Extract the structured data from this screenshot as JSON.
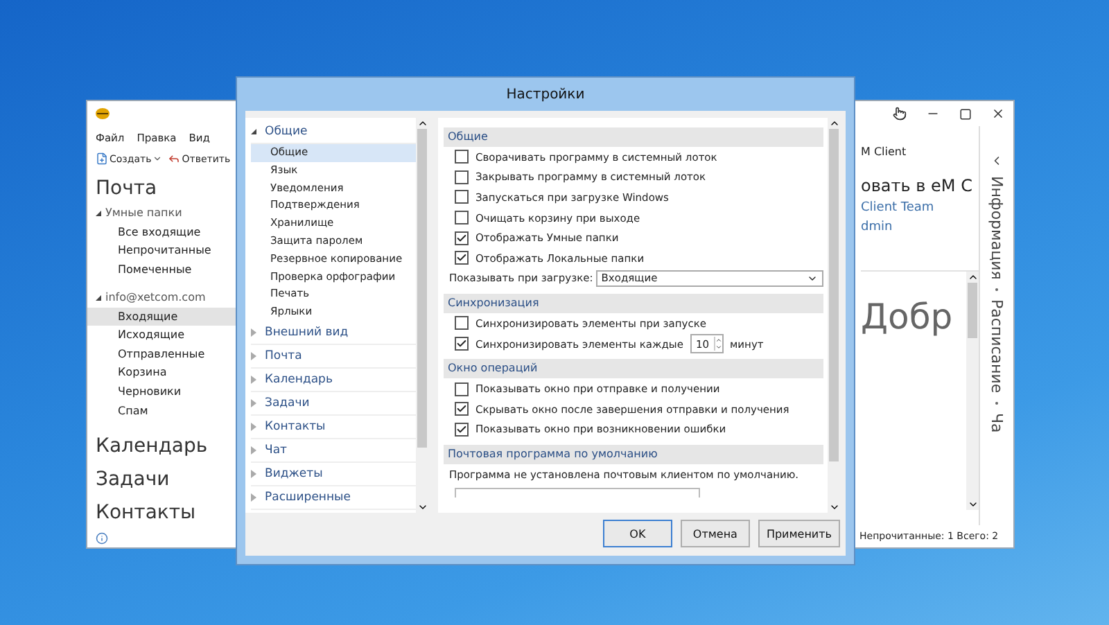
{
  "mail_window": {
    "menu": [
      "Файл",
      "Правка",
      "Вид"
    ],
    "toolbar": [
      {
        "kind": "new",
        "label": "Создать"
      },
      {
        "kind": "reply",
        "label": "Ответить"
      }
    ],
    "nav": [
      {
        "label": "Почта",
        "groups": [
          {
            "label": "Умные папки",
            "expanded": true,
            "selected": false,
            "children": [
              {
                "label": "Все входящие",
                "selected": false
              },
              {
                "label": "Непрочитанные",
                "selected": false
              },
              {
                "label": "Помеченные",
                "selected": false
              }
            ]
          },
          {
            "label": "info@xetcom.com",
            "expanded": true,
            "selected": false,
            "children": [
              {
                "label": "Входящие",
                "selected": true
              },
              {
                "label": "Исходящие",
                "selected": false
              },
              {
                "label": "Отправленные",
                "selected": false
              },
              {
                "label": "Корзина",
                "selected": false
              },
              {
                "label": "Черновики",
                "selected": false
              },
              {
                "label": "Спам",
                "selected": false
              }
            ]
          }
        ]
      },
      {
        "label": "Календарь"
      },
      {
        "label": "Задачи"
      },
      {
        "label": "Контакты"
      }
    ],
    "reading_pane": {
      "title": "M Client",
      "subject": "овать в eM C",
      "from": "Client Team",
      "to": "dmin",
      "preview_text": "Добр"
    },
    "side_tabs": [
      "Информация",
      "Расписание",
      "Ча"
    ],
    "status": "Непрочитанные: 1 Всего: 2"
  },
  "dialog": {
    "title": "Настройки",
    "categories": [
      {
        "label": "Общие",
        "expanded": true,
        "selected": false,
        "children": [
          {
            "label": "Общие",
            "selected": true
          },
          {
            "label": "Язык",
            "selected": false
          },
          {
            "label": "Уведомления",
            "selected": false
          },
          {
            "label": "Подтверждения",
            "selected": false
          },
          {
            "label": "Хранилище",
            "selected": false
          },
          {
            "label": "Защита паролем",
            "selected": false
          },
          {
            "label": "Резервное копирование",
            "selected": false
          },
          {
            "label": "Проверка орфографии",
            "selected": false
          },
          {
            "label": "Печать",
            "selected": false
          },
          {
            "label": "Ярлыки",
            "selected": false
          }
        ]
      },
      {
        "label": "Внешний вид",
        "expanded": false,
        "selected": false
      },
      {
        "label": "Почта",
        "expanded": false,
        "selected": false
      },
      {
        "label": "Календарь",
        "expanded": false,
        "selected": false
      },
      {
        "label": "Задачи",
        "expanded": false,
        "selected": false
      },
      {
        "label": "Контакты",
        "expanded": false,
        "selected": false
      },
      {
        "label": "Чат",
        "expanded": false,
        "selected": false
      },
      {
        "label": "Виджеты",
        "expanded": false,
        "selected": false
      },
      {
        "label": "Расширенные",
        "expanded": false,
        "selected": false
      }
    ],
    "sections": [
      {
        "title": "Общие",
        "items": [
          {
            "kind": "checkbox",
            "label": "Сворачивать программу в системный лоток",
            "checked": false
          },
          {
            "kind": "checkbox",
            "label": "Закрывать программу в системный лоток",
            "checked": false
          },
          {
            "kind": "checkbox",
            "label": "Запускаться при загрузке Windows",
            "checked": false
          },
          {
            "kind": "checkbox",
            "label": "Очищать корзину при выходе",
            "checked": false
          },
          {
            "kind": "checkbox",
            "label": "Отображать Умные папки",
            "checked": true
          },
          {
            "kind": "checkbox",
            "label": "Отображать Локальные папки",
            "checked": true
          },
          {
            "kind": "select",
            "label": "Показывать при загрузке:",
            "value": "Входящие"
          }
        ]
      },
      {
        "title": "Синхронизация",
        "items": [
          {
            "kind": "checkbox",
            "label": "Синхронизировать элементы при запуске",
            "checked": false
          },
          {
            "kind": "spinner",
            "label": "Синхронизировать элементы каждые",
            "checked": true,
            "value": "10",
            "unit": "минут"
          }
        ]
      },
      {
        "title": "Окно операций",
        "items": [
          {
            "kind": "checkbox",
            "label": "Показывать окно при отправке и получении",
            "checked": false
          },
          {
            "kind": "checkbox",
            "label": "Скрывать окно после завершения отправки и получения",
            "checked": true
          },
          {
            "kind": "checkbox",
            "label": "Показывать окно при возникновении ошибки",
            "checked": true
          }
        ]
      },
      {
        "title": "Почтовая программа по умолчанию",
        "items": [
          {
            "kind": "text",
            "label": "Программа не установлена почтовым клиентом по умолчанию."
          },
          {
            "kind": "field"
          }
        ]
      }
    ],
    "buttons": [
      {
        "label": "OK",
        "default": true
      },
      {
        "label": "Отмена",
        "default": false
      },
      {
        "label": "Применить",
        "default": false
      }
    ]
  }
}
